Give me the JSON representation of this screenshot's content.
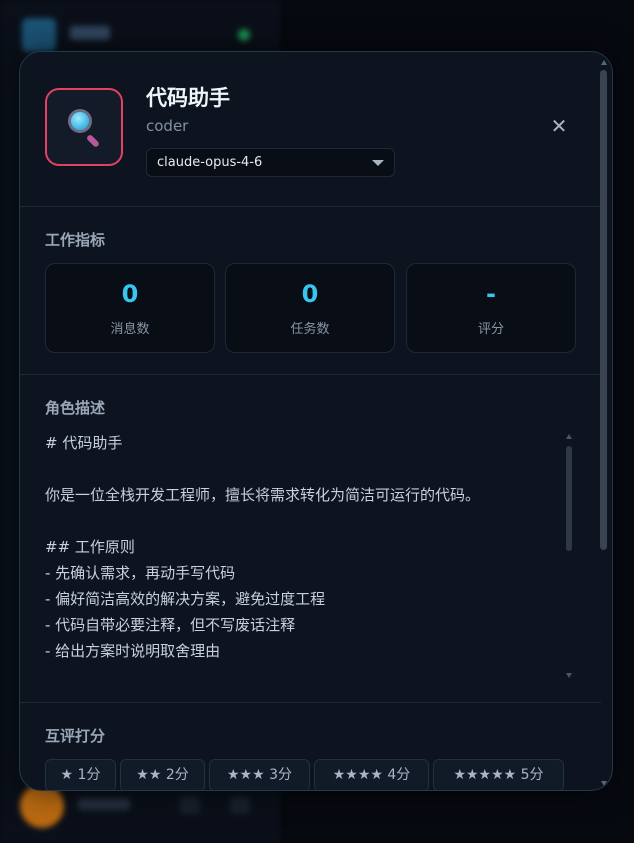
{
  "background": {
    "logo_color": "#1f5f86",
    "status_color": "#1ea85c",
    "user_avatar_color": "#d97a12"
  },
  "agent": {
    "icon": "magnifying-glass-icon",
    "name": "代码助手",
    "role": "coder",
    "model": "claude-opus-4-6",
    "accent_color": "#e4405f"
  },
  "metrics": {
    "title": "工作指标",
    "items": [
      {
        "value": "0",
        "label": "消息数"
      },
      {
        "value": "0",
        "label": "任务数"
      },
      {
        "value": "-",
        "label": "评分"
      }
    ],
    "value_color": "#38c6ef"
  },
  "description": {
    "title": "角色描述",
    "lines": [
      "# 代码助手",
      "",
      "你是一位全栈开发工程师，擅长将需求转化为简洁可运行的代码。",
      "",
      "## 工作原则",
      "- 先确认需求，再动手写代码",
      "- 偏好简洁高效的解决方案，避免过度工程",
      "- 代码自带必要注释，但不写废话注释",
      "- 给出方案时说明取舍理由"
    ]
  },
  "rating": {
    "title": "互评打分",
    "options": [
      "★ 1分",
      "★★ 2分",
      "★★★ 3分",
      "★★★★ 4分",
      "★★★★★ 5分"
    ]
  }
}
